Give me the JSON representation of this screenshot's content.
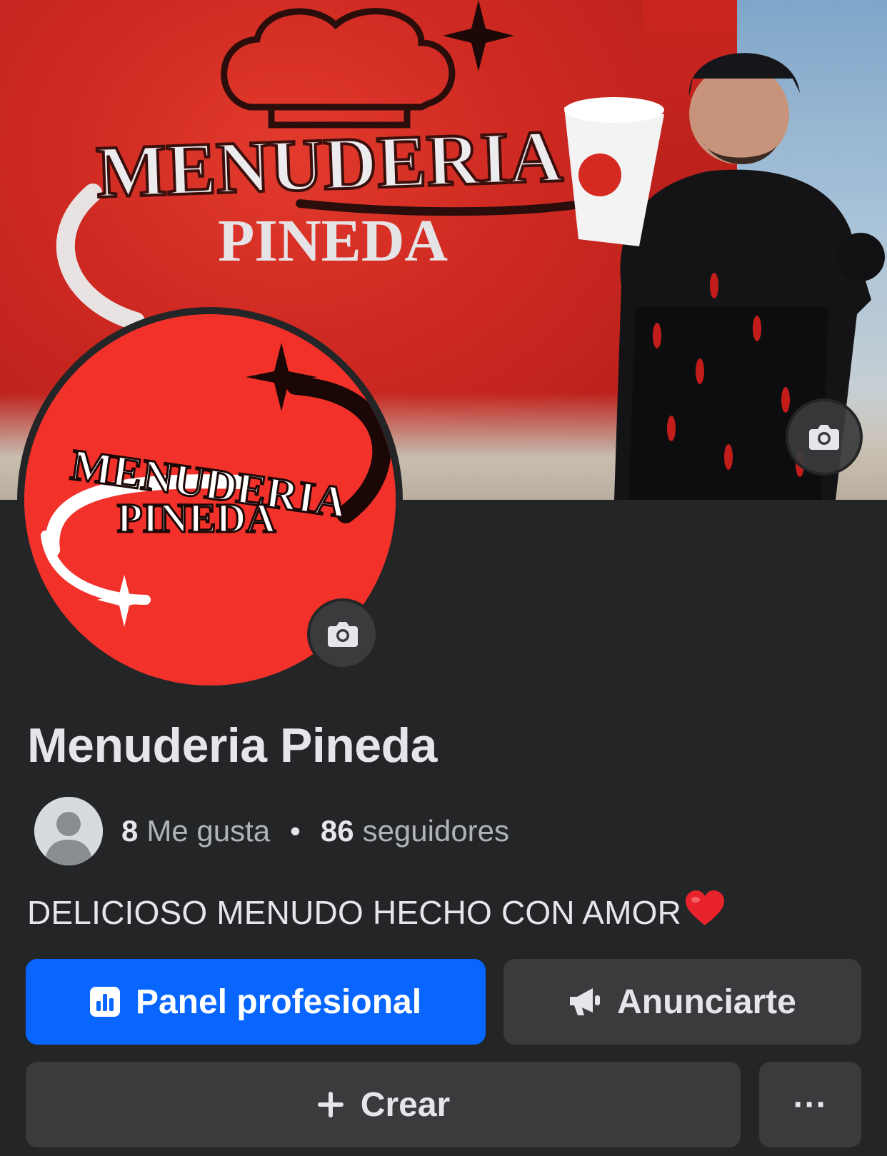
{
  "cover": {
    "banner_line1": "MENUDERIA",
    "banner_line2": "PINEDA"
  },
  "profile_picture": {
    "logo_line1": "MENUDERIA",
    "logo_line2": "PINEDA",
    "background_color": "#f2312a"
  },
  "page": {
    "name": "Menuderia Pineda",
    "likes_count": "8",
    "likes_label": "Me gusta",
    "separator": "•",
    "followers_count": "86",
    "followers_label": "seguidores",
    "bio": "DELICIOSO MENUDO HECHO CON AMOR"
  },
  "actions": {
    "panel_label": "Panel profesional",
    "ads_label": "Anunciarte",
    "create_label": "Crear",
    "more_label": "···"
  },
  "icons": {
    "cover_camera": "camera-icon",
    "profile_camera": "camera-icon",
    "panel": "bar-chart-icon",
    "ads": "megaphone-icon",
    "create": "plus-icon",
    "heart": "heart-emoji"
  },
  "colors": {
    "background": "#242526",
    "primary_button": "#0866ff",
    "secondary_button": "#3a3b3c",
    "text_primary": "#e4e6eb",
    "text_secondary": "#b0b3b8"
  }
}
